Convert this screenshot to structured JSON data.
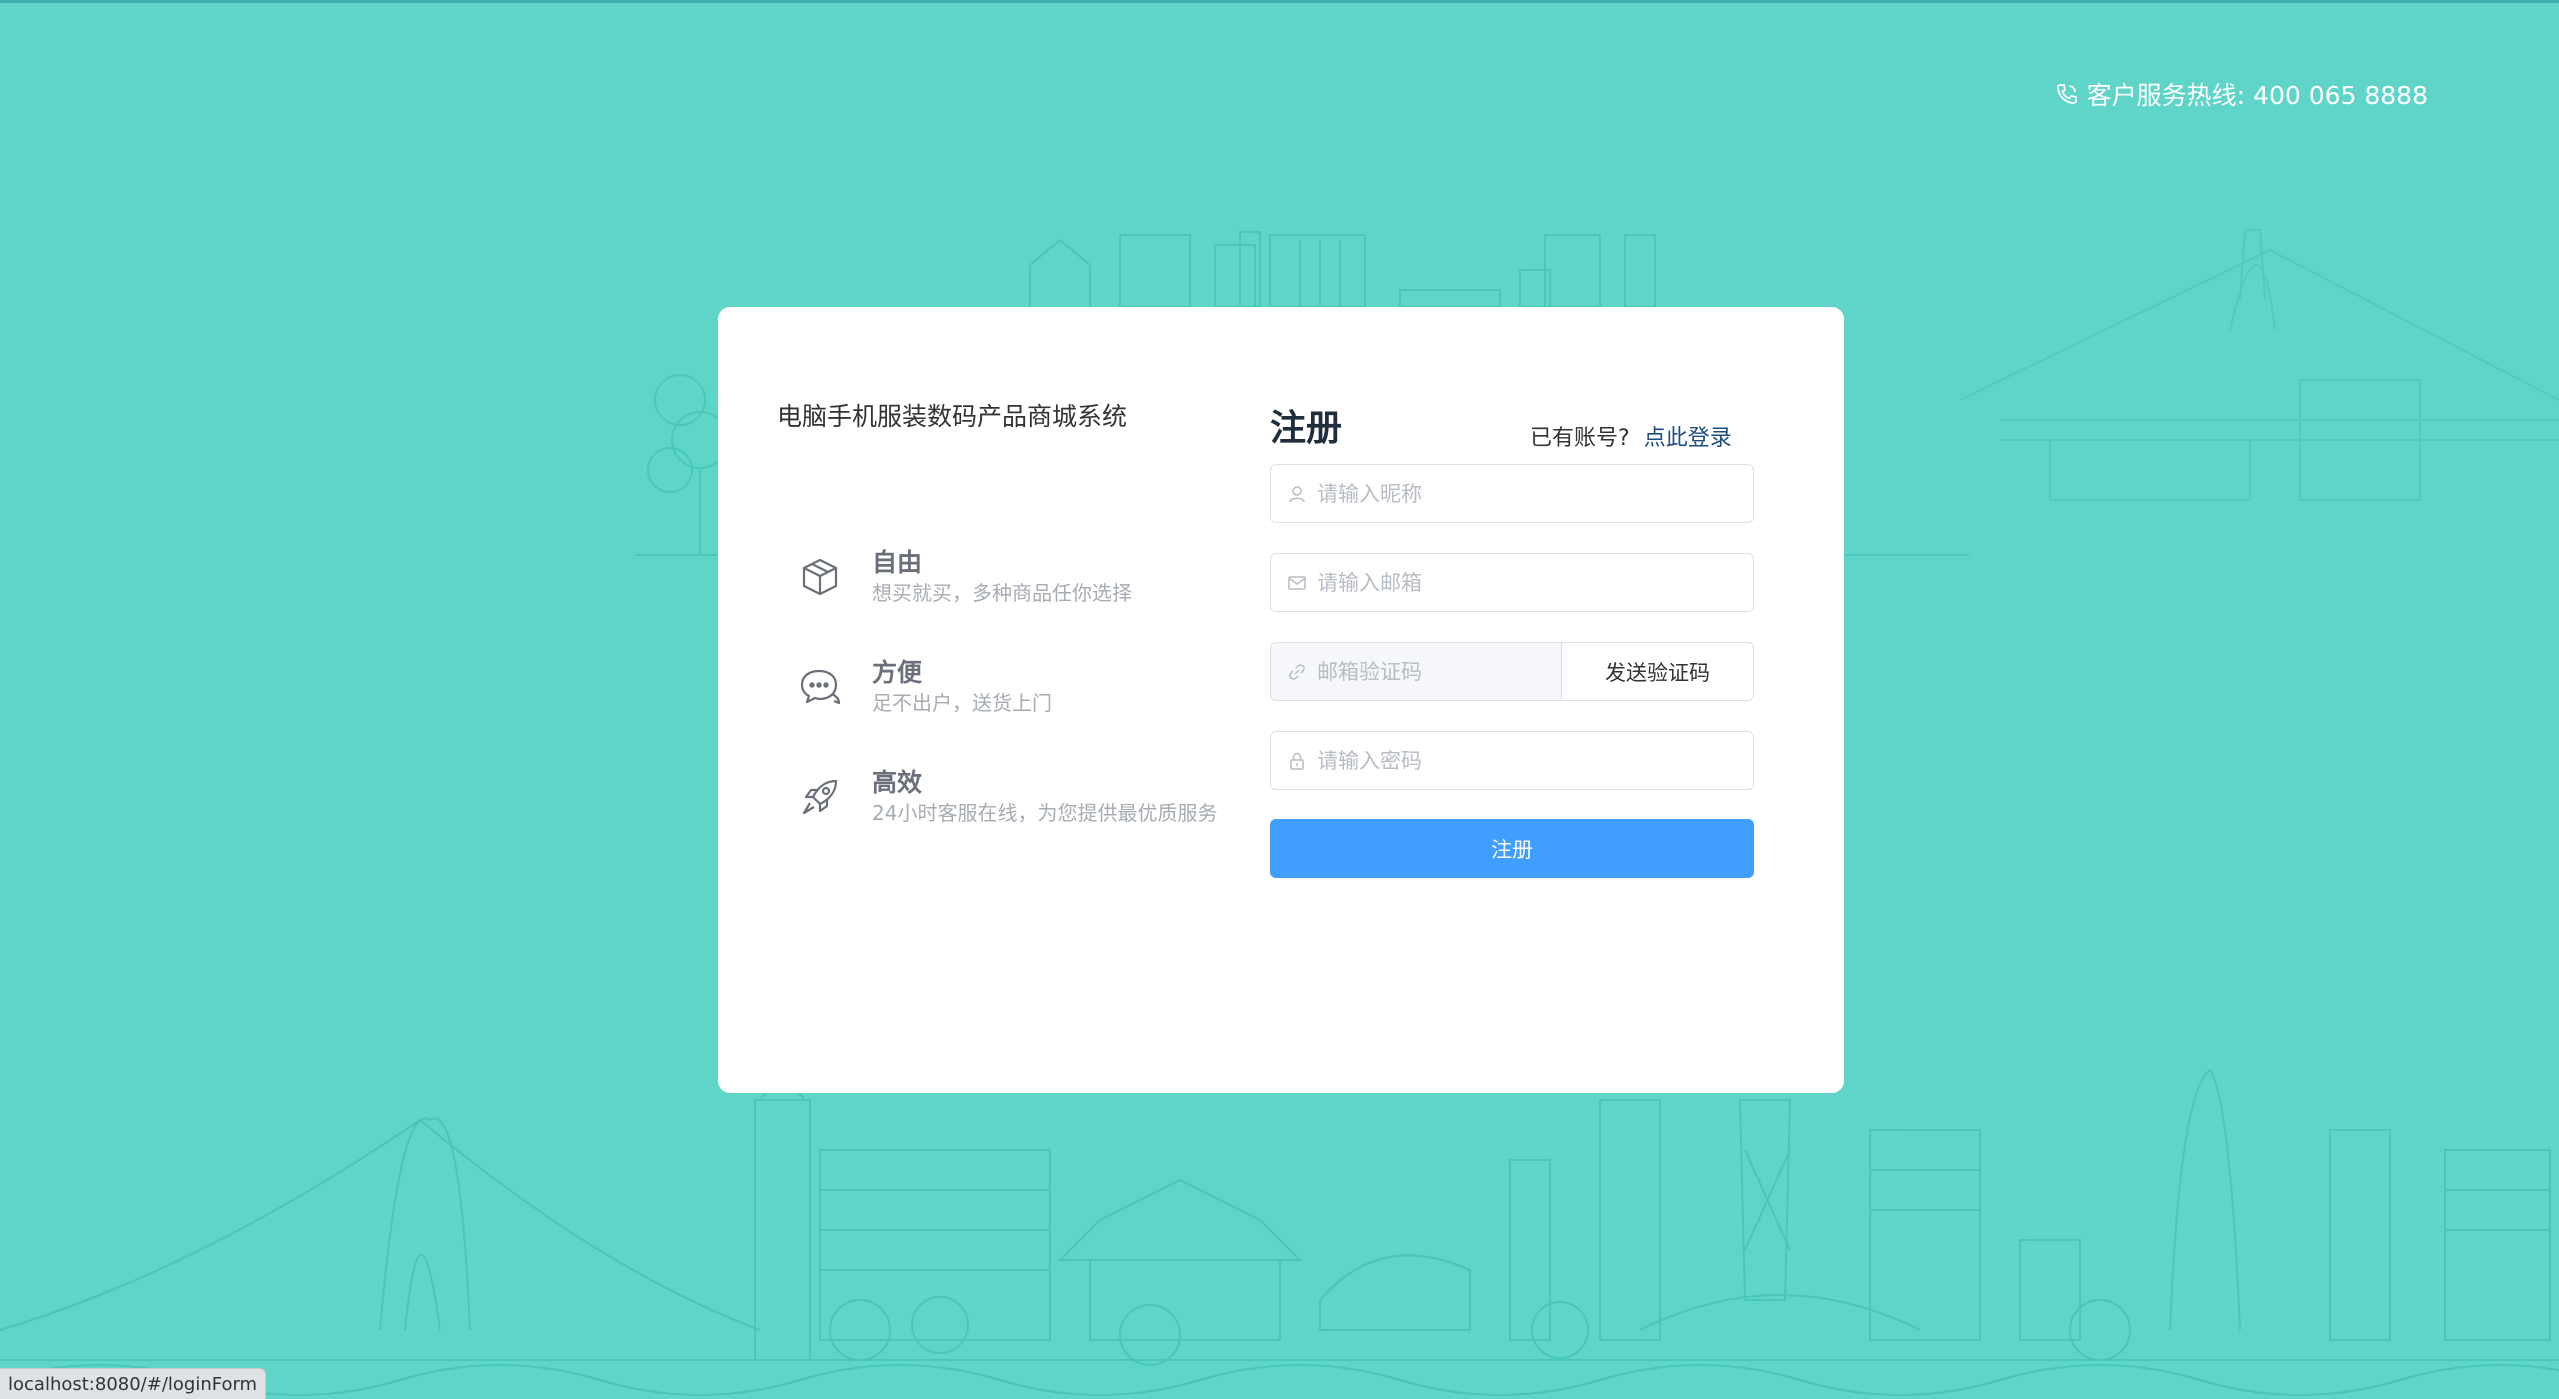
{
  "header": {
    "hotline_icon": "phone-icon",
    "hotline_text": "客户服务热线: 400 065 8888"
  },
  "left_panel": {
    "system_title": "电脑手机服装数码产品商城系统",
    "features": [
      {
        "icon": "box-icon",
        "title": "自由",
        "desc": "想买就买，多种商品任你选择"
      },
      {
        "icon": "chat-icon",
        "title": "方便",
        "desc": "足不出户，送货上门"
      },
      {
        "icon": "rocket-icon",
        "title": "高效",
        "desc": "24小时客服在线，为您提供最优质服务"
      }
    ]
  },
  "register_form": {
    "title": "注册",
    "have_account_text": "已有账号?",
    "login_link": "点此登录",
    "nickname_placeholder": "请输入昵称",
    "email_placeholder": "请输入邮箱",
    "code_placeholder": "邮箱验证码",
    "send_code_label": "发送验证码",
    "password_placeholder": "请输入密码",
    "submit_label": "注册"
  },
  "status_bar": {
    "url": "localhost:8080/#/loginForm"
  },
  "colors": {
    "background": "#5ed5c8",
    "primary_button": "#409eff",
    "link": "#1c4e7e"
  }
}
